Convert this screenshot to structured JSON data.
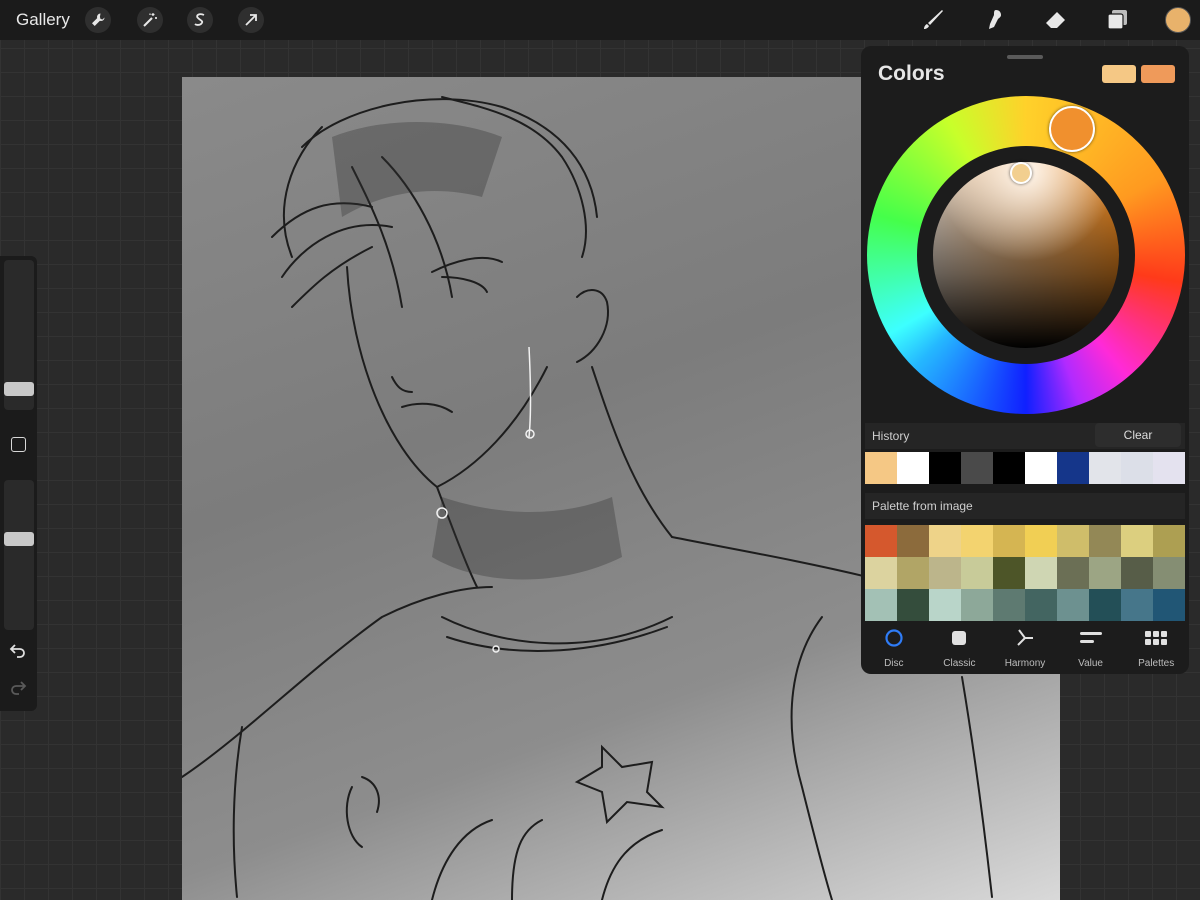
{
  "topbar": {
    "gallery_label": "Gallery",
    "left_tools": [
      "wrench-icon",
      "magic-wand-icon",
      "selection-s-icon",
      "arrow-cursor-icon"
    ],
    "right_tools": [
      "brush-icon",
      "smudge-icon",
      "eraser-icon",
      "layers-icon"
    ],
    "current_color": "#e8b26b"
  },
  "sidebar": {
    "brush_size_level": 0.9,
    "opacity_level": 0.38
  },
  "colors_panel": {
    "title": "Colors",
    "primary_swatch": "#f5c885",
    "secondary_swatch": "#ef9a5a",
    "history": {
      "label": "History",
      "clear_label": "Clear",
      "swatches": [
        "#f5c885",
        "#ffffff",
        "#000000",
        "#4a4a4a",
        "#000000",
        "#ffffff",
        "#15368a",
        "#e2e4ea",
        "#dcdfe8",
        "#e4e2ef"
      ]
    },
    "palette": {
      "label": "Palette from image",
      "swatches": [
        "#d5582d",
        "#8c6b3c",
        "#eed389",
        "#f3d36f",
        "#d5b552",
        "#f1cf54",
        "#cfbd6a",
        "#938856",
        "#dccf7f",
        "#ad9f52",
        "#dcd39f",
        "#b1a566",
        "#bcb58b",
        "#c8cb99",
        "#4d5528",
        "#cfd6b3",
        "#6b6f55",
        "#9ca584",
        "#575d48",
        "#858e73",
        "#a3c1b5",
        "#344d3c",
        "#b9d5c9",
        "#8da899",
        "#5e7a71",
        "#436561",
        "#6d9190",
        "#234f57",
        "#46768a",
        "#215675"
      ]
    },
    "tabs": [
      {
        "label": "Disc",
        "icon": "disc-icon"
      },
      {
        "label": "Classic",
        "icon": "classic-square-icon"
      },
      {
        "label": "Harmony",
        "icon": "harmony-icon"
      },
      {
        "label": "Value",
        "icon": "value-sliders-icon"
      },
      {
        "label": "Palettes",
        "icon": "palettes-grid-icon"
      }
    ],
    "active_tab": "Disc"
  }
}
